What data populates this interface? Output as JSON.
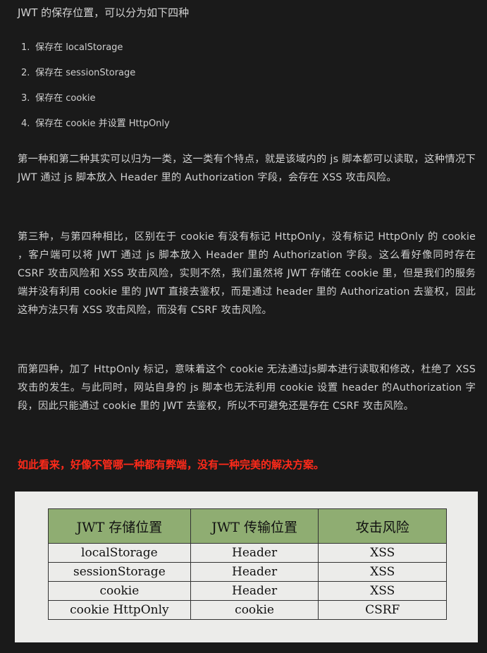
{
  "intro": "JWT 的保存位置，可以分为如下四种",
  "list": [
    {
      "num": "1.",
      "text": "保存在 localStorage"
    },
    {
      "num": "2.",
      "text": "保存在 sessionStorage"
    },
    {
      "num": "3.",
      "text": "保存在 cookie"
    },
    {
      "num": "4.",
      "text": "保存在 cookie 并设置 HttpOnly"
    }
  ],
  "paragraphs": [
    "第一种和第二种其实可以归为一类，这一类有个特点，就是该域内的 js 脚本都可以读取，这种情况下 JWT 通过 js 脚本放入 Header 里的 Authorization 字段，会存在 XSS 攻击风险。",
    "第三种，与第四种相比，区别在于 cookie 有没有标记 HttpOnly，没有标记 HttpOnly 的 cookie ，客户端可以将 JWT 通过 js 脚本放入 Header 里的 Authorization 字段。这么看好像同时存在CSRF 攻击风险和 XSS 攻击风险，实则不然，我们虽然将 JWT 存储在 cookie 里，但是我们的服务端并没有利用 cookie 里的 JWT 直接去鉴权，而是通过 header 里的 Authorization 去鉴权，因此这种方法只有 XSS 攻击风险，而没有 CSRF 攻击风险。",
    "而第四种，加了 HttpOnly 标记，意味着这个 cookie 无法通过js脚本进行读取和修改，杜绝了 XSS 攻击的发生。与此同时，网站自身的 js 脚本也无法利用 cookie 设置 header 的Authorization 字段，因此只能通过 cookie 里的 JWT 去鉴权，所以不可避免还是存在 CSRF 攻击风险。"
  ],
  "warning": "如此看来，好像不管哪一种都有弊端，没有一种完美的解决方案。",
  "table": {
    "headers": [
      "JWT 存储位置",
      "JWT 传输位置",
      "攻击风险"
    ],
    "rows": [
      [
        "localStorage",
        "Header",
        "XSS"
      ],
      [
        "sessionStorage",
        "Header",
        "XSS"
      ],
      [
        "cookie",
        "Header",
        "XSS"
      ],
      [
        "cookie HttpOnly",
        "cookie",
        "CSRF"
      ]
    ]
  },
  "colors": {
    "background": "#1a1a1a",
    "text": "#d0d0d0",
    "warning": "#ff2a1a",
    "table_header": "#8fad72"
  }
}
